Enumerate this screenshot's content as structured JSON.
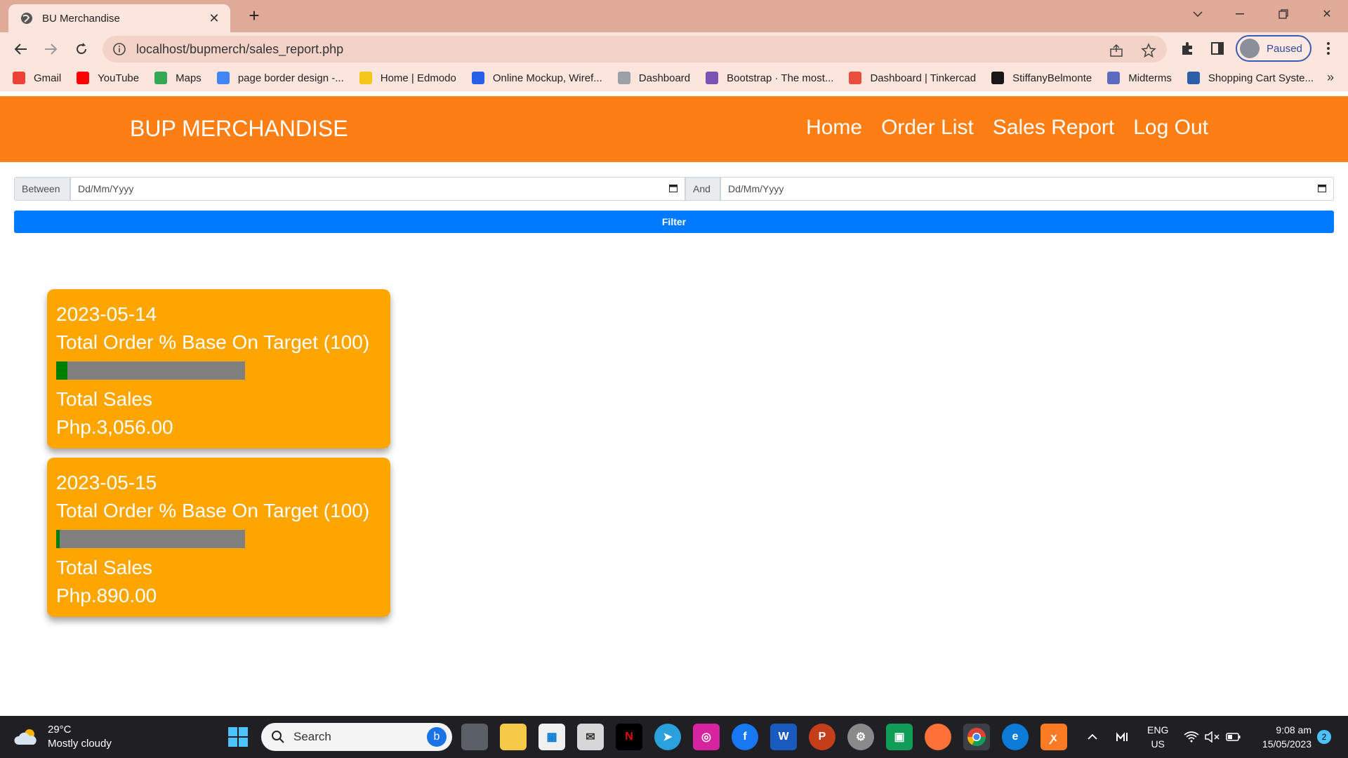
{
  "browser": {
    "tab_title": "BU Merchandise",
    "url": "localhost/bupmerch/sales_report.php",
    "profile_label": "Paused",
    "bookmarks": [
      {
        "label": "Gmail",
        "icon": "gmail-icon",
        "color": "#ea4335"
      },
      {
        "label": "YouTube",
        "icon": "youtube-icon",
        "color": "#ff0000"
      },
      {
        "label": "Maps",
        "icon": "maps-icon",
        "color": "#34a853"
      },
      {
        "label": "page border design -...",
        "icon": "google-icon",
        "color": "#4285f4"
      },
      {
        "label": "Home | Edmodo",
        "icon": "edmodo-icon",
        "color": "#f5c518"
      },
      {
        "label": "Online Mockup, Wiref...",
        "icon": "moqups-icon",
        "color": "#2660e8"
      },
      {
        "label": "Dashboard",
        "icon": "dashboard-icon",
        "color": "#9aa0a6"
      },
      {
        "label": "Bootstrap · The most...",
        "icon": "bootstrap-icon",
        "color": "#7952b3"
      },
      {
        "label": "Dashboard | Tinkercad",
        "icon": "tinkercad-icon",
        "color": "#e84d3d"
      },
      {
        "label": "StiffanyBelmonte",
        "icon": "github-icon",
        "color": "#181717"
      },
      {
        "label": "Midterms",
        "icon": "list-icon",
        "color": "#5c6bc0"
      },
      {
        "label": "Shopping Cart Syste...",
        "icon": "code-icon",
        "color": "#2d5fa8"
      }
    ]
  },
  "navbar": {
    "brand": "BUP MERCHANDISE",
    "links": [
      "Home",
      "Order List",
      "Sales Report",
      "Log Out"
    ]
  },
  "filter": {
    "between_label": "Between",
    "and_label": "And",
    "start_placeholder": "Dd/Mm/Yyyy",
    "end_placeholder": "Dd/Mm/Yyyy",
    "button_label": "Filter"
  },
  "reports": [
    {
      "date": "2023-05-14",
      "target_label": "Total Order % Base On Target (100)",
      "progress_percent": 6,
      "sales_label": "Total Sales",
      "sales_value": "Php.3,056.00"
    },
    {
      "date": "2023-05-15",
      "target_label": "Total Order % Base On Target (100)",
      "progress_percent": 2,
      "sales_label": "Total Sales",
      "sales_value": "Php.890.00"
    }
  ],
  "taskbar": {
    "temperature": "29°C",
    "weather": "Mostly cloudy",
    "search_label": "Search",
    "lang_top": "ENG",
    "lang_bottom": "US",
    "time": "9:08 am",
    "date": "15/05/2023",
    "notification_count": "2"
  }
}
